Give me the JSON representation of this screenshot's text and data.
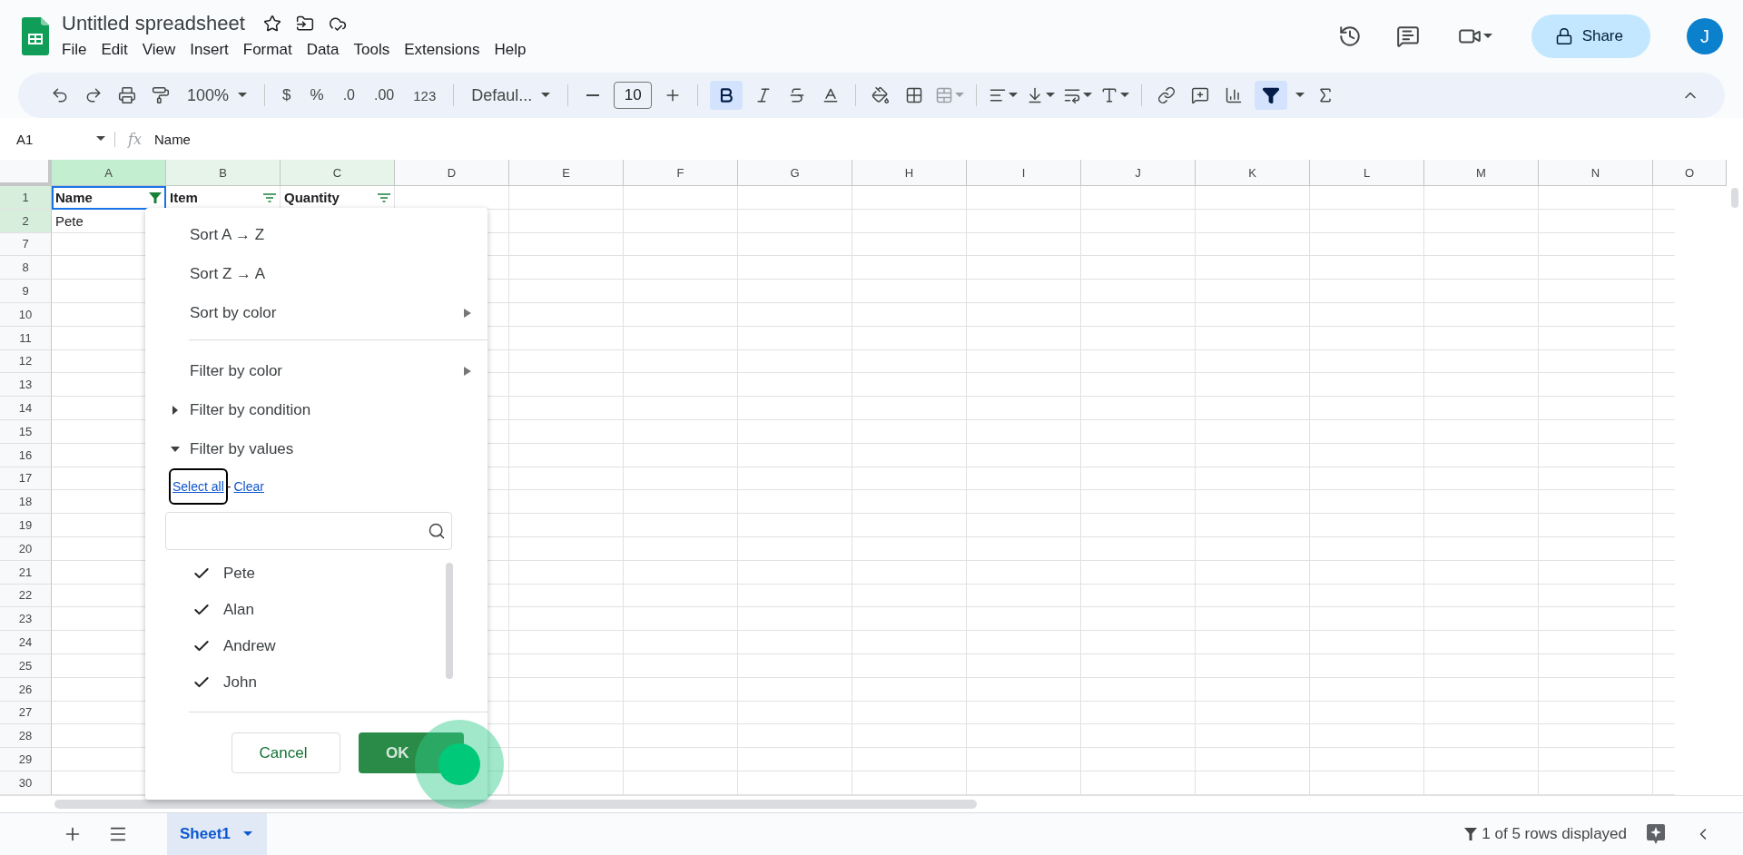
{
  "doc": {
    "title": "Untitled spreadsheet"
  },
  "menu": [
    "File",
    "Edit",
    "View",
    "Insert",
    "Format",
    "Data",
    "Tools",
    "Extensions",
    "Help"
  ],
  "share": "Share",
  "avatar": "J",
  "toolbar": {
    "zoom": "100%",
    "currency": "$",
    "percent": "%",
    "dec_decrease": ".0",
    "dec_increase": ".00",
    "number_format": "123",
    "font": "Defaul...",
    "font_size": "10",
    "bold_on": true,
    "filter_on": true
  },
  "formula_bar": {
    "cell_ref": "A1",
    "fx": "fx",
    "value": "Name"
  },
  "columns": [
    {
      "label": "A",
      "selected": true,
      "in_range": true
    },
    {
      "label": "B",
      "selected": false,
      "in_range": true
    },
    {
      "label": "C",
      "selected": false,
      "in_range": true
    },
    {
      "label": "D",
      "selected": false,
      "in_range": false
    },
    {
      "label": "E",
      "selected": false,
      "in_range": false
    },
    {
      "label": "F",
      "selected": false,
      "in_range": false
    },
    {
      "label": "G",
      "selected": false,
      "in_range": false
    },
    {
      "label": "H",
      "selected": false,
      "in_range": false
    },
    {
      "label": "I",
      "selected": false,
      "in_range": false
    },
    {
      "label": "J",
      "selected": false,
      "in_range": false
    },
    {
      "label": "K",
      "selected": false,
      "in_range": false
    },
    {
      "label": "L",
      "selected": false,
      "in_range": false
    },
    {
      "label": "M",
      "selected": false,
      "in_range": false
    },
    {
      "label": "N",
      "selected": false,
      "in_range": false
    },
    {
      "label": "O",
      "selected": false,
      "in_range": false
    }
  ],
  "header_row": {
    "number": "1",
    "in_range": true,
    "cells": [
      {
        "text": "Name",
        "filter_active": true
      },
      {
        "text": "Item",
        "filter_active": false
      },
      {
        "text": "Quantity",
        "filter_active": false
      }
    ]
  },
  "rows": [
    {
      "number": "2",
      "in_range": true,
      "cells": [
        "Pete"
      ]
    },
    {
      "number": "7",
      "in_range": false
    },
    {
      "number": "8",
      "in_range": false
    },
    {
      "number": "9",
      "in_range": false
    },
    {
      "number": "10",
      "in_range": false
    },
    {
      "number": "11",
      "in_range": false
    },
    {
      "number": "12",
      "in_range": false
    },
    {
      "number": "13",
      "in_range": false
    },
    {
      "number": "14",
      "in_range": false
    },
    {
      "number": "15",
      "in_range": false
    },
    {
      "number": "16",
      "in_range": false
    },
    {
      "number": "17",
      "in_range": false
    },
    {
      "number": "18",
      "in_range": false
    },
    {
      "number": "19",
      "in_range": false
    },
    {
      "number": "20",
      "in_range": false
    },
    {
      "number": "21",
      "in_range": false
    },
    {
      "number": "22",
      "in_range": false
    },
    {
      "number": "23",
      "in_range": false
    },
    {
      "number": "24",
      "in_range": false
    },
    {
      "number": "25",
      "in_range": false
    },
    {
      "number": "26",
      "in_range": false
    },
    {
      "number": "27",
      "in_range": false
    },
    {
      "number": "28",
      "in_range": false
    },
    {
      "number": "29",
      "in_range": false
    },
    {
      "number": "30",
      "in_range": false
    }
  ],
  "filter_menu": {
    "items": [
      {
        "kind": "action",
        "label": "Sort A → Z"
      },
      {
        "kind": "action",
        "label": "Sort Z → A"
      },
      {
        "kind": "submenu",
        "label": "Sort by color"
      },
      {
        "kind": "divider"
      },
      {
        "kind": "submenu",
        "label": "Filter by color"
      },
      {
        "kind": "section",
        "label": "Filter by condition",
        "expanded": false
      },
      {
        "kind": "section",
        "label": "Filter by values",
        "expanded": true
      }
    ],
    "select_all": "Select all",
    "separator": "-",
    "clear": "Clear",
    "values": [
      {
        "label": "Pete",
        "checked": true
      },
      {
        "label": "Alan",
        "checked": true
      },
      {
        "label": "Andrew",
        "checked": true
      },
      {
        "label": "John",
        "checked": true
      }
    ],
    "cancel": "Cancel",
    "ok": "OK"
  },
  "sheet_tabs": [
    {
      "label": "Sheet1",
      "selected": true
    }
  ],
  "status": "1 of 5 rows displayed"
}
